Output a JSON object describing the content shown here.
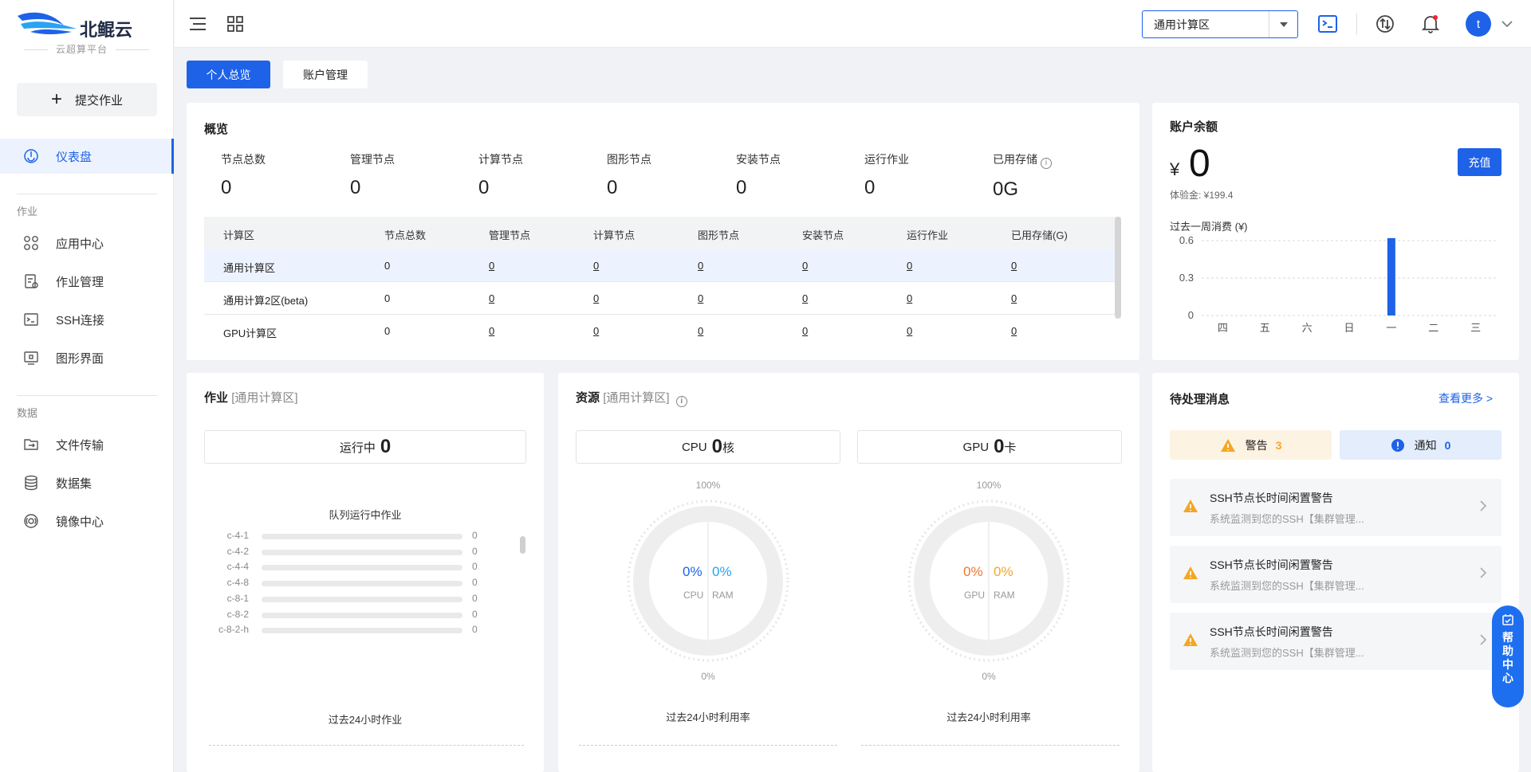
{
  "brand": {
    "name": "北鲲云",
    "subtitle": "云超算平台"
  },
  "sidebar": {
    "submit_label": "提交作业",
    "dashboard": "仪表盘",
    "section_jobs": "作业",
    "items_jobs": [
      {
        "label": "应用中心",
        "icon": "apps-icon"
      },
      {
        "label": "作业管理",
        "icon": "job-manage-icon"
      },
      {
        "label": "SSH连接",
        "icon": "terminal-icon"
      },
      {
        "label": "图形界面",
        "icon": "monitor-icon"
      }
    ],
    "section_data": "数据",
    "items_data": [
      {
        "label": "文件传输",
        "icon": "file-transfer-icon"
      },
      {
        "label": "数据集",
        "icon": "database-icon"
      },
      {
        "label": "镜像中心",
        "icon": "image-center-icon"
      }
    ]
  },
  "header": {
    "zone": "通用计算区",
    "avatar": "t"
  },
  "tabs": {
    "personal": "个人总览",
    "account": "账户管理"
  },
  "overview": {
    "title": "概览",
    "stats": [
      {
        "label": "节点总数",
        "value": "0"
      },
      {
        "label": "管理节点",
        "value": "0"
      },
      {
        "label": "计算节点",
        "value": "0"
      },
      {
        "label": "图形节点",
        "value": "0"
      },
      {
        "label": "安装节点",
        "value": "0"
      },
      {
        "label": "运行作业",
        "value": "0"
      },
      {
        "label": "已用存储",
        "value": "0G"
      }
    ],
    "columns": [
      "计算区",
      "节点总数",
      "管理节点",
      "计算节点",
      "图形节点",
      "安装节点",
      "运行作业",
      "已用存储(G)"
    ],
    "rows": [
      [
        "通用计算区",
        "0",
        "0",
        "0",
        "0",
        "0",
        "0",
        "0"
      ],
      [
        "通用计算2区(beta)",
        "0",
        "0",
        "0",
        "0",
        "0",
        "0",
        "0"
      ],
      [
        "GPU计算区",
        "0",
        "0",
        "0",
        "0",
        "0",
        "0",
        "0"
      ]
    ]
  },
  "balance": {
    "title": "账户余额",
    "currency": "¥",
    "value": "0",
    "recharge": "充值",
    "trial": "体验金: ¥199.4",
    "weekly_label": "过去一周消费 (¥)"
  },
  "chart_data": {
    "type": "bar",
    "categories": [
      "四",
      "五",
      "六",
      "日",
      "一",
      "二",
      "三"
    ],
    "values": [
      0,
      0,
      0,
      0,
      0.62,
      0,
      0
    ],
    "yticks": [
      "0",
      "0.3",
      "0.6"
    ],
    "ylim": [
      0,
      0.6
    ],
    "color": "#1e62e8",
    "grid": true
  },
  "jobs": {
    "title": "作业",
    "zone": "[通用计算区]",
    "running_label": "运行中",
    "running_value": "0",
    "queue_title": "队列运行中作业",
    "queues": [
      {
        "name": "c-4-1",
        "value": "0"
      },
      {
        "name": "c-4-2",
        "value": "0"
      },
      {
        "name": "c-4-4",
        "value": "0"
      },
      {
        "name": "c-4-8",
        "value": "0"
      },
      {
        "name": "c-8-1",
        "value": "0"
      },
      {
        "name": "c-8-2",
        "value": "0"
      },
      {
        "name": "c-8-2-h",
        "value": "0"
      }
    ],
    "past24": "过去24小时作业"
  },
  "resources": {
    "title": "资源",
    "zone": "[通用计算区]",
    "cpu_label": "CPU",
    "cpu_value": "0",
    "cpu_unit": "核",
    "gpu_label": "GPU",
    "gpu_value": "0",
    "gpu_unit": "卡",
    "top_pct": "100%",
    "bottom_pct": "0%",
    "cpu_gauge": {
      "a": "0%",
      "b": "0%",
      "la": "CPU",
      "lb": "RAM"
    },
    "gpu_gauge": {
      "a": "0%",
      "b": "0%",
      "la": "GPU",
      "lb": "RAM"
    },
    "past24": "过去24小时利用率"
  },
  "messages": {
    "title": "待处理消息",
    "more": "查看更多 >",
    "warn_label": "警告",
    "warn_count": "3",
    "note_label": "通知",
    "note_count": "0",
    "items": [
      {
        "title": "SSH节点长时间闲置警告",
        "desc": "系统监测到您的SSH【集群管理..."
      },
      {
        "title": "SSH节点长时间闲置警告",
        "desc": "系统监测到您的SSH【集群管理..."
      },
      {
        "title": "SSH节点长时间闲置警告",
        "desc": "系统监测到您的SSH【集群管理..."
      }
    ]
  },
  "help": {
    "label": "帮助中心"
  }
}
